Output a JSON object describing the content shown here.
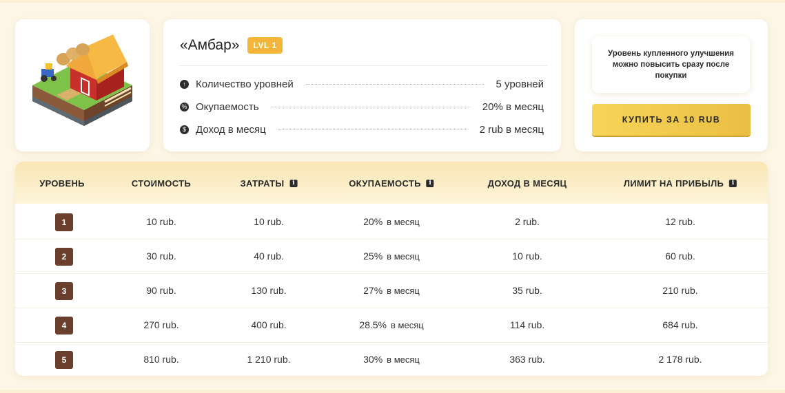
{
  "building": {
    "name": "«Амбар»",
    "level_badge": "LVL 1",
    "stats": [
      {
        "icon": "arrow-up-circle-icon",
        "label": "Количество уровней",
        "value": "5 уровней"
      },
      {
        "icon": "percent-circle-icon",
        "label": "Окупаемость",
        "value": "20% в месяц"
      },
      {
        "icon": "dollar-circle-icon",
        "label": "Доход в месяц",
        "value": "2 rub в месяц"
      }
    ]
  },
  "purchase": {
    "note": "Уровень купленного улучшения можно повысить сразу после покупки",
    "buy_label": "КУПИТЬ ЗА 10 RUB"
  },
  "table": {
    "headers": {
      "level": "УРОВЕНЬ",
      "cost": "СТОИМОСТЬ",
      "expenses": "ЗАТРАТЫ",
      "payback": "ОКУПАЕМОСТЬ",
      "income": "ДОХОД В МЕСЯЦ",
      "limit": "ЛИМИТ НА ПРИБЫЛЬ"
    },
    "per_month": "в месяц",
    "rows": [
      {
        "level": "1",
        "cost": "10 rub.",
        "expenses": "10 rub.",
        "payback": "20%",
        "income": "2 rub.",
        "limit": "12 rub."
      },
      {
        "level": "2",
        "cost": "30 rub.",
        "expenses": "40 rub.",
        "payback": "25%",
        "income": "10 rub.",
        "limit": "60 rub."
      },
      {
        "level": "3",
        "cost": "90 rub.",
        "expenses": "130 rub.",
        "payback": "27%",
        "income": "35 rub.",
        "limit": "210 rub."
      },
      {
        "level": "4",
        "cost": "270 rub.",
        "expenses": "400 rub.",
        "payback": "28.5%",
        "income": "114 rub.",
        "limit": "684 rub."
      },
      {
        "level": "5",
        "cost": "810 rub.",
        "expenses": "1 210 rub.",
        "payback": "30%",
        "income": "363 rub.",
        "limit": "2 178 rub."
      }
    ]
  }
}
